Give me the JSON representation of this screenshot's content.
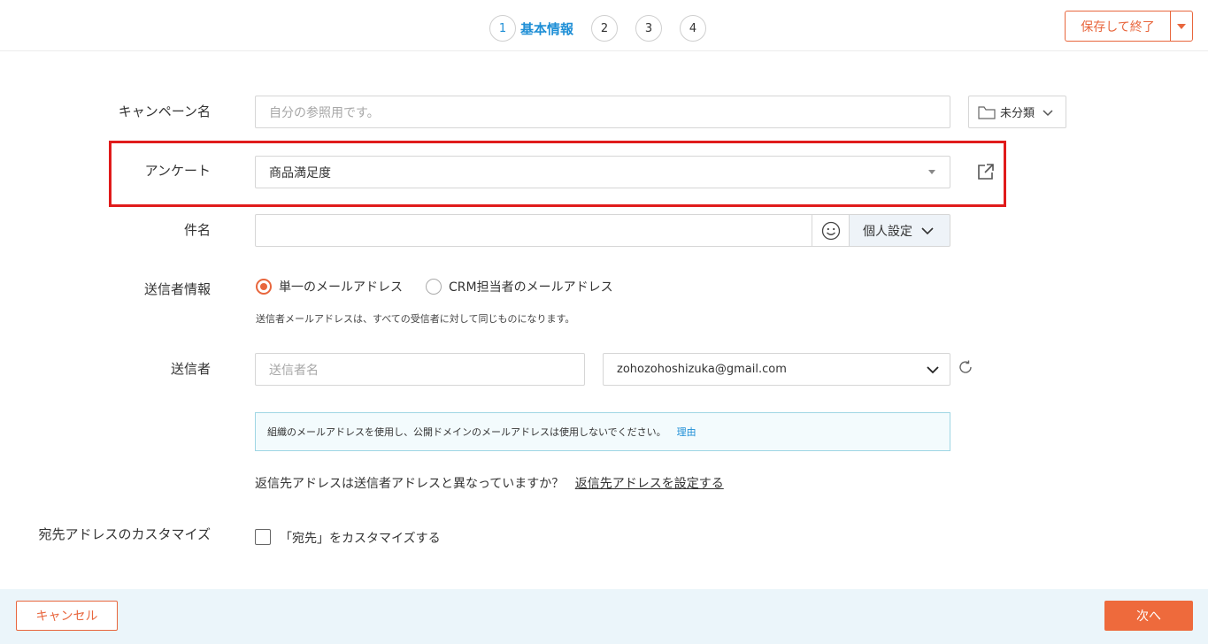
{
  "header": {
    "steps": [
      {
        "number": "1",
        "label": "基本情報"
      },
      {
        "number": "2"
      },
      {
        "number": "3"
      },
      {
        "number": "4"
      }
    ],
    "save_label": "保存して終了"
  },
  "form": {
    "campaign_name": {
      "label": "キャンペーン名",
      "placeholder": "自分の参照用です。",
      "value": ""
    },
    "folder": {
      "label": "未分類"
    },
    "survey": {
      "label": "アンケート",
      "selected": "商品満足度"
    },
    "subject": {
      "label": "件名",
      "value": "",
      "personalize_label": "個人設定"
    },
    "sender_info": {
      "label": "送信者情報",
      "options": [
        {
          "label": "単一のメールアドレス",
          "selected": true
        },
        {
          "label": "CRM担当者のメールアドレス",
          "selected": false
        }
      ],
      "hint": "送信者メールアドレスは、すべての受信者に対して同じものになります。"
    },
    "sender": {
      "label": "送信者",
      "name_placeholder": "送信者名",
      "email": "zohozohoshizuka@gmail.com"
    },
    "notice": {
      "text": "組織のメールアドレスを使用し、公開ドメインのメールアドレスは使用しないでください。",
      "link": "理由"
    },
    "reply_to": {
      "question": "返信先アドレスは送信者アドレスと異なっていますか？",
      "link": "返信先アドレスを設定する"
    },
    "recipient_customize": {
      "label": "宛先アドレスのカスタマイズ",
      "checkbox_label": "「宛先」をカスタマイズする",
      "checked": false
    }
  },
  "footer": {
    "cancel_label": "キャンセル",
    "next_label": "次へ"
  },
  "colors": {
    "accent": "#e8663d",
    "link": "#1f8fd6",
    "highlight": "#e01b1b"
  }
}
